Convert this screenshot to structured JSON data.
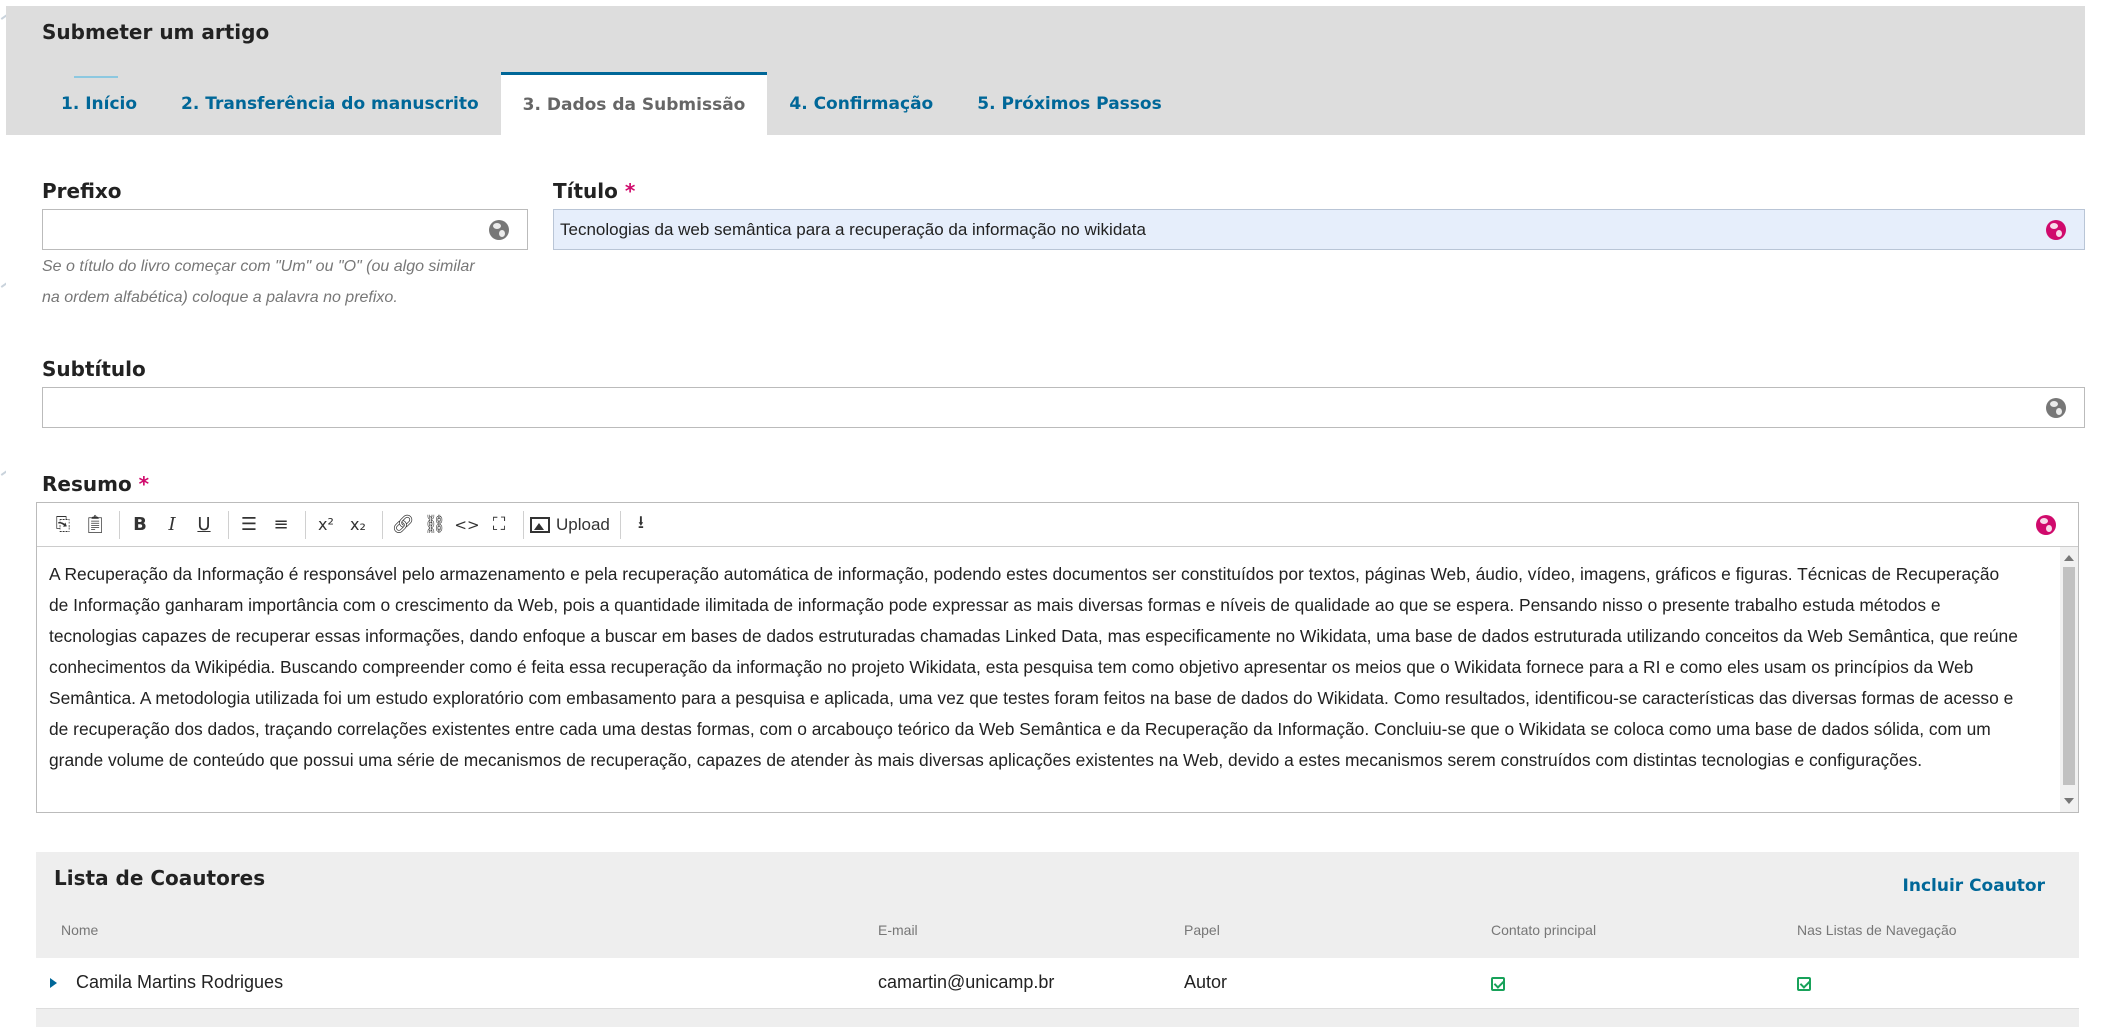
{
  "header": {
    "title": "Submeter um artigo",
    "tabs": [
      {
        "label": "1. Início",
        "state": "visited"
      },
      {
        "label": "2. Transferência do manuscrito",
        "state": "visited"
      },
      {
        "label": "3. Dados da Submissão",
        "state": "active"
      },
      {
        "label": "4. Confirmação",
        "state": "pending"
      },
      {
        "label": "5. Próximos Passos",
        "state": "pending"
      }
    ]
  },
  "form": {
    "prefix": {
      "label": "Prefixo",
      "value": "",
      "help_line1": "Se o título do livro começar com \"Um\" ou \"O\" (ou algo similar",
      "help_line2": "na ordem alfabética) coloque a palavra no prefixo."
    },
    "title": {
      "label": "Título",
      "required_mark": "*",
      "value": "Tecnologias da web semântica para a recuperação da informação no wikidata"
    },
    "subtitle": {
      "label": "Subtítulo",
      "value": ""
    },
    "abstract": {
      "label": "Resumo",
      "required_mark": "*",
      "upload_label": "Upload",
      "text": "A Recuperação da Informação é responsável pelo armazenamento e pela recuperação automática de informação, podendo estes documentos ser constituídos por textos, páginas Web, áudio, vídeo, imagens, gráficos e figuras. Técnicas de Recuperação de Informação ganharam importância com o crescimento da Web, pois a quantidade ilimitada de informação pode expressar as mais diversas formas e níveis de qualidade ao que se espera. Pensando nisso o presente trabalho estuda métodos e tecnologias capazes de recuperar essas informações, dando enfoque a buscar em bases de dados estruturadas chamadas Linked Data, mas especificamente no Wikidata, uma base de dados estruturada utilizando conceitos da Web Semântica, que reúne conhecimentos da Wikipédia. Buscando compreender como é feita essa recuperação da informação no projeto Wikidata, esta pesquisa tem como objetivo apresentar os meios que o Wikidata fornece para a RI e como eles usam os princípios da Web Semântica. A metodologia utilizada foi um estudo exploratório com embasamento para a pesquisa e aplicada, uma vez que testes foram feitos na base de dados do Wikidata. Como resultados, identificou-se características das diversas formas de acesso e de recuperação dos dados, traçando correlações existentes entre cada uma destas formas, com o arcabouço teórico da Web Semântica e da Recuperação da Informação. Concluiu-se que o Wikidata se coloca como uma base de dados sólida, com um grande volume de conteúdo que possui uma série de mecanismos de recuperação, capazes de atender às mais diversas aplicações existentes na Web, devido a estes mecanismos serem construídos com distintas tecnologias e configurações."
    }
  },
  "coauthors": {
    "title": "Lista de Coautores",
    "add_label": "Incluir Coautor",
    "columns": [
      "Nome",
      "E-mail",
      "Papel",
      "Contato principal",
      "Nas Listas de Navegação"
    ],
    "rows": [
      {
        "name": "Camila Martins Rodrigues",
        "email": "camartin@unicamp.br",
        "role": "Autor",
        "primary_contact": true,
        "in_browse_lists": true
      }
    ]
  },
  "colors": {
    "accent": "#006798",
    "required": "#d00a6c",
    "check": "#18a25a"
  }
}
